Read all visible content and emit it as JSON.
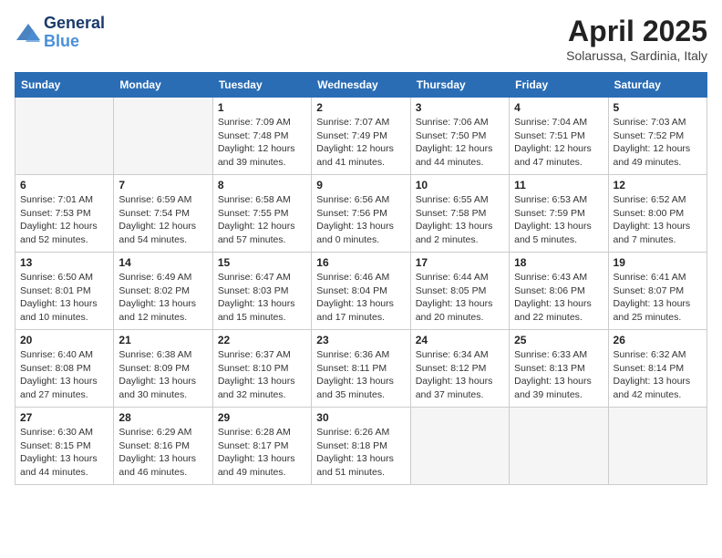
{
  "logo": {
    "line1": "General",
    "line2": "Blue"
  },
  "title": "April 2025",
  "subtitle": "Solarussa, Sardinia, Italy",
  "days_header": [
    "Sunday",
    "Monday",
    "Tuesday",
    "Wednesday",
    "Thursday",
    "Friday",
    "Saturday"
  ],
  "weeks": [
    [
      {
        "day": "",
        "info": ""
      },
      {
        "day": "",
        "info": ""
      },
      {
        "day": "1",
        "info": "Sunrise: 7:09 AM\nSunset: 7:48 PM\nDaylight: 12 hours and 39 minutes."
      },
      {
        "day": "2",
        "info": "Sunrise: 7:07 AM\nSunset: 7:49 PM\nDaylight: 12 hours and 41 minutes."
      },
      {
        "day": "3",
        "info": "Sunrise: 7:06 AM\nSunset: 7:50 PM\nDaylight: 12 hours and 44 minutes."
      },
      {
        "day": "4",
        "info": "Sunrise: 7:04 AM\nSunset: 7:51 PM\nDaylight: 12 hours and 47 minutes."
      },
      {
        "day": "5",
        "info": "Sunrise: 7:03 AM\nSunset: 7:52 PM\nDaylight: 12 hours and 49 minutes."
      }
    ],
    [
      {
        "day": "6",
        "info": "Sunrise: 7:01 AM\nSunset: 7:53 PM\nDaylight: 12 hours and 52 minutes."
      },
      {
        "day": "7",
        "info": "Sunrise: 6:59 AM\nSunset: 7:54 PM\nDaylight: 12 hours and 54 minutes."
      },
      {
        "day": "8",
        "info": "Sunrise: 6:58 AM\nSunset: 7:55 PM\nDaylight: 12 hours and 57 minutes."
      },
      {
        "day": "9",
        "info": "Sunrise: 6:56 AM\nSunset: 7:56 PM\nDaylight: 13 hours and 0 minutes."
      },
      {
        "day": "10",
        "info": "Sunrise: 6:55 AM\nSunset: 7:58 PM\nDaylight: 13 hours and 2 minutes."
      },
      {
        "day": "11",
        "info": "Sunrise: 6:53 AM\nSunset: 7:59 PM\nDaylight: 13 hours and 5 minutes."
      },
      {
        "day": "12",
        "info": "Sunrise: 6:52 AM\nSunset: 8:00 PM\nDaylight: 13 hours and 7 minutes."
      }
    ],
    [
      {
        "day": "13",
        "info": "Sunrise: 6:50 AM\nSunset: 8:01 PM\nDaylight: 13 hours and 10 minutes."
      },
      {
        "day": "14",
        "info": "Sunrise: 6:49 AM\nSunset: 8:02 PM\nDaylight: 13 hours and 12 minutes."
      },
      {
        "day": "15",
        "info": "Sunrise: 6:47 AM\nSunset: 8:03 PM\nDaylight: 13 hours and 15 minutes."
      },
      {
        "day": "16",
        "info": "Sunrise: 6:46 AM\nSunset: 8:04 PM\nDaylight: 13 hours and 17 minutes."
      },
      {
        "day": "17",
        "info": "Sunrise: 6:44 AM\nSunset: 8:05 PM\nDaylight: 13 hours and 20 minutes."
      },
      {
        "day": "18",
        "info": "Sunrise: 6:43 AM\nSunset: 8:06 PM\nDaylight: 13 hours and 22 minutes."
      },
      {
        "day": "19",
        "info": "Sunrise: 6:41 AM\nSunset: 8:07 PM\nDaylight: 13 hours and 25 minutes."
      }
    ],
    [
      {
        "day": "20",
        "info": "Sunrise: 6:40 AM\nSunset: 8:08 PM\nDaylight: 13 hours and 27 minutes."
      },
      {
        "day": "21",
        "info": "Sunrise: 6:38 AM\nSunset: 8:09 PM\nDaylight: 13 hours and 30 minutes."
      },
      {
        "day": "22",
        "info": "Sunrise: 6:37 AM\nSunset: 8:10 PM\nDaylight: 13 hours and 32 minutes."
      },
      {
        "day": "23",
        "info": "Sunrise: 6:36 AM\nSunset: 8:11 PM\nDaylight: 13 hours and 35 minutes."
      },
      {
        "day": "24",
        "info": "Sunrise: 6:34 AM\nSunset: 8:12 PM\nDaylight: 13 hours and 37 minutes."
      },
      {
        "day": "25",
        "info": "Sunrise: 6:33 AM\nSunset: 8:13 PM\nDaylight: 13 hours and 39 minutes."
      },
      {
        "day": "26",
        "info": "Sunrise: 6:32 AM\nSunset: 8:14 PM\nDaylight: 13 hours and 42 minutes."
      }
    ],
    [
      {
        "day": "27",
        "info": "Sunrise: 6:30 AM\nSunset: 8:15 PM\nDaylight: 13 hours and 44 minutes."
      },
      {
        "day": "28",
        "info": "Sunrise: 6:29 AM\nSunset: 8:16 PM\nDaylight: 13 hours and 46 minutes."
      },
      {
        "day": "29",
        "info": "Sunrise: 6:28 AM\nSunset: 8:17 PM\nDaylight: 13 hours and 49 minutes."
      },
      {
        "day": "30",
        "info": "Sunrise: 6:26 AM\nSunset: 8:18 PM\nDaylight: 13 hours and 51 minutes."
      },
      {
        "day": "",
        "info": ""
      },
      {
        "day": "",
        "info": ""
      },
      {
        "day": "",
        "info": ""
      }
    ]
  ]
}
